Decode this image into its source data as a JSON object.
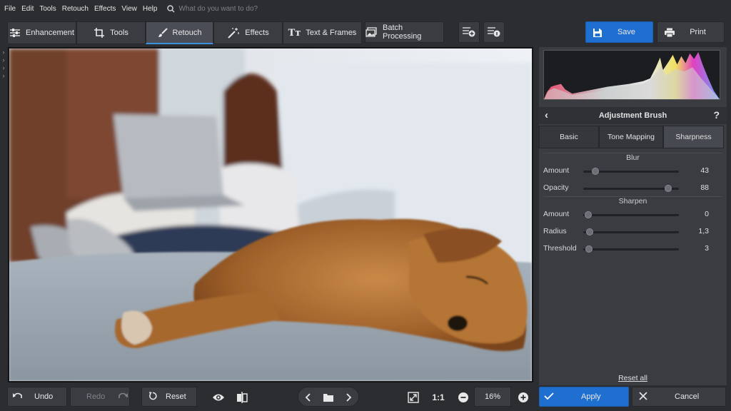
{
  "menu": [
    "File",
    "Edit",
    "Tools",
    "Retouch",
    "Effects",
    "View",
    "Help"
  ],
  "search": {
    "placeholder": "What do you want to do?"
  },
  "tabs": [
    {
      "label": "Enhancement",
      "icon": "sliders-icon"
    },
    {
      "label": "Tools",
      "icon": "crop-icon"
    },
    {
      "label": "Retouch",
      "icon": "brush-icon",
      "active": true
    },
    {
      "label": "Effects",
      "icon": "magic-wand-icon"
    },
    {
      "label": "Text & Frames",
      "icon": "text-icon"
    }
  ],
  "toolbar": {
    "batch_label": "Batch Processing",
    "save_label": "Save",
    "print_label": "Print",
    "accent": "#1e6fd0"
  },
  "panel": {
    "title": "Adjustment Brush",
    "help": "?",
    "tabs": [
      "Basic",
      "Tone Mapping",
      "Sharpness"
    ],
    "active_tab": "Sharpness",
    "blur": {
      "title": "Blur",
      "sliders": [
        {
          "label": "Amount",
          "value": "43",
          "fraction": 0.13
        },
        {
          "label": "Opacity",
          "value": "88",
          "fraction": 0.89
        }
      ]
    },
    "sharpen": {
      "title": "Sharpen",
      "sliders": [
        {
          "label": "Amount",
          "value": "0",
          "fraction": 0.05
        },
        {
          "label": "Radius",
          "value": "1,3",
          "fraction": 0.07
        },
        {
          "label": "Threshold",
          "value": "3",
          "fraction": 0.06
        }
      ]
    },
    "reset_all": "Reset all"
  },
  "bottom": {
    "undo_label": "Undo",
    "redo_label": "Redo",
    "reset_label": "Reset",
    "zoom_one": "1:1",
    "zoom_value": "16%",
    "apply_label": "Apply",
    "cancel_label": "Cancel"
  }
}
